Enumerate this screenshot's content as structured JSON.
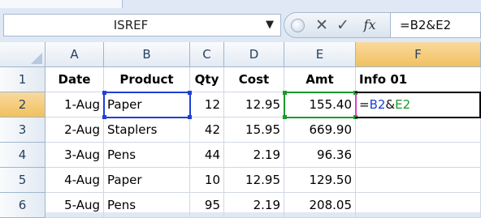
{
  "name_box": {
    "value": "ISREF"
  },
  "formula_bar": {
    "cancel_glyph": "✕",
    "enter_glyph": "✓",
    "fx_label": "fx",
    "formula": "=B2&E2"
  },
  "columns": [
    "A",
    "B",
    "C",
    "D",
    "E",
    "F"
  ],
  "rows": [
    "1",
    "2",
    "3",
    "4",
    "5",
    "6"
  ],
  "header_row": [
    "Date",
    "Product",
    "Qty",
    "Cost",
    "Amt",
    "Info 01"
  ],
  "data_rows": [
    [
      "1-Aug",
      "Paper",
      "12",
      "12.95",
      "155.40"
    ],
    [
      "2-Aug",
      "Staplers",
      "42",
      "15.95",
      "669.90"
    ],
    [
      "3-Aug",
      "Pens",
      "44",
      "2.19",
      "96.36"
    ],
    [
      "4-Aug",
      "Paper",
      "10",
      "12.95",
      "129.50"
    ],
    [
      "5-Aug",
      "Pens",
      "95",
      "2.19",
      "208.05"
    ]
  ],
  "edit_cell": {
    "address": "F2",
    "tokens": {
      "eq": "=",
      "ref1": "B2",
      "amp": "&",
      "ref2": "E2"
    }
  },
  "colors": {
    "ref1": "#1f3fd6",
    "ref2": "#1a9a2a",
    "header_active": "#f1c15f"
  }
}
